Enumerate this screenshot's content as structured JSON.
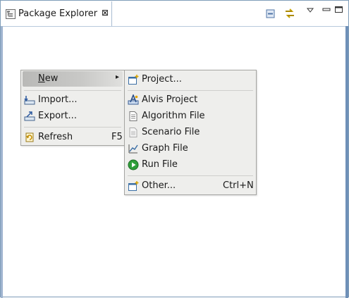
{
  "view": {
    "tab_title": "Package Explorer",
    "tab_close_glyph": "⊠",
    "icons": [
      "package-explorer-icon",
      "close-icon",
      "collapse-all-icon",
      "link-with-editor-icon",
      "view-menu-icon",
      "minimize-icon",
      "maximize-icon"
    ]
  },
  "context_menu": {
    "items": [
      {
        "label": "New",
        "mnemonic": "N",
        "submenu": true,
        "selected": true
      },
      {
        "label": "Import...",
        "icon": "import-icon"
      },
      {
        "label": "Export...",
        "icon": "export-icon"
      },
      {
        "label": "Refresh",
        "shortcut": "F5",
        "icon": "refresh-icon"
      }
    ]
  },
  "new_submenu": {
    "items": [
      {
        "label": "Project...",
        "icon": "new-project-icon"
      },
      {
        "label": "Alvis Project",
        "icon": "alvis-project-icon"
      },
      {
        "label": "Algorithm File",
        "icon": "algorithm-file-icon"
      },
      {
        "label": "Scenario File",
        "icon": "scenario-file-icon"
      },
      {
        "label": "Graph File",
        "icon": "graph-file-icon"
      },
      {
        "label": "Run File",
        "icon": "run-file-icon"
      },
      {
        "label": "Other...",
        "shortcut": "Ctrl+N",
        "icon": "new-other-icon"
      }
    ]
  },
  "colors": {
    "menu_bg": "#eeeeec",
    "selection": "#c4c4c2",
    "frame_border": "#7f9db9"
  }
}
